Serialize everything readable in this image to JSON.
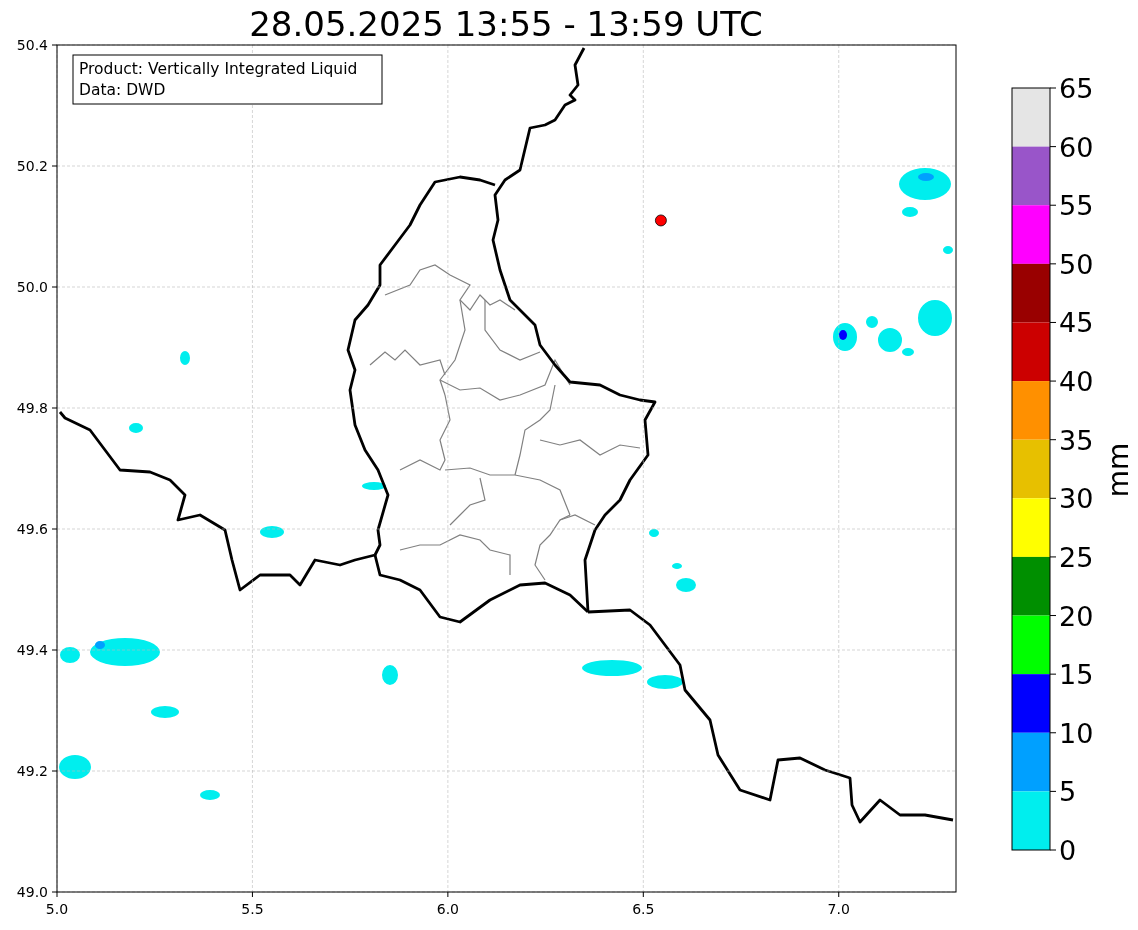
{
  "map": {
    "chart_data": {
      "type": "scatter",
      "title": "28.05.2025 13:55 - 13:59 UTC",
      "x": [
        6.545
      ],
      "series": [
        {
          "color": "#ff0000",
          "values": [
            50.11
          ]
        }
      ],
      "grid": true,
      "xlim": [
        5.0,
        7.3
      ],
      "ylim": [
        49.0,
        50.4
      ],
      "xticks": [
        {
          "value": 5.0,
          "label": "5.0"
        },
        {
          "value": 5.5,
          "label": "5.5"
        },
        {
          "value": 6.0,
          "label": "6.0"
        },
        {
          "value": 6.5,
          "label": "6.5"
        },
        {
          "value": 7.0,
          "label": "7.0"
        }
      ],
      "yticks": [
        {
          "value": 49.0,
          "label": "49.0"
        },
        {
          "value": 49.2,
          "label": "49.2"
        },
        {
          "value": 49.4,
          "label": "49.4"
        },
        {
          "value": 49.6,
          "label": "49.6"
        },
        {
          "value": 49.8,
          "label": "49.8"
        },
        {
          "value": 50.0,
          "label": "50.0"
        },
        {
          "value": 50.2,
          "label": "50.2"
        },
        {
          "value": 50.4,
          "label": "50.4"
        }
      ]
    },
    "info_box": [
      "Product: Vertically Integrated Liquid",
      "Data: DWD"
    ]
  },
  "colorbar": {
    "label": "mm",
    "ticks": [
      "65",
      "60",
      "55",
      "50",
      "45",
      "40",
      "35",
      "30",
      "25",
      "20",
      "15",
      "10",
      "5",
      "0"
    ],
    "bins": [
      {
        "color": "#e5e5e5"
      },
      {
        "color": "#9955c9"
      },
      {
        "color": "#ff00ff"
      },
      {
        "color": "#990000"
      },
      {
        "color": "#cc0000"
      },
      {
        "color": "#ff9000"
      },
      {
        "color": "#e7c000"
      },
      {
        "color": "#ffff00"
      },
      {
        "color": "#008f00"
      },
      {
        "color": "#00ff00"
      },
      {
        "color": "#0000ff"
      },
      {
        "color": "#00a0ff"
      },
      {
        "color": "#00eeee"
      }
    ]
  }
}
